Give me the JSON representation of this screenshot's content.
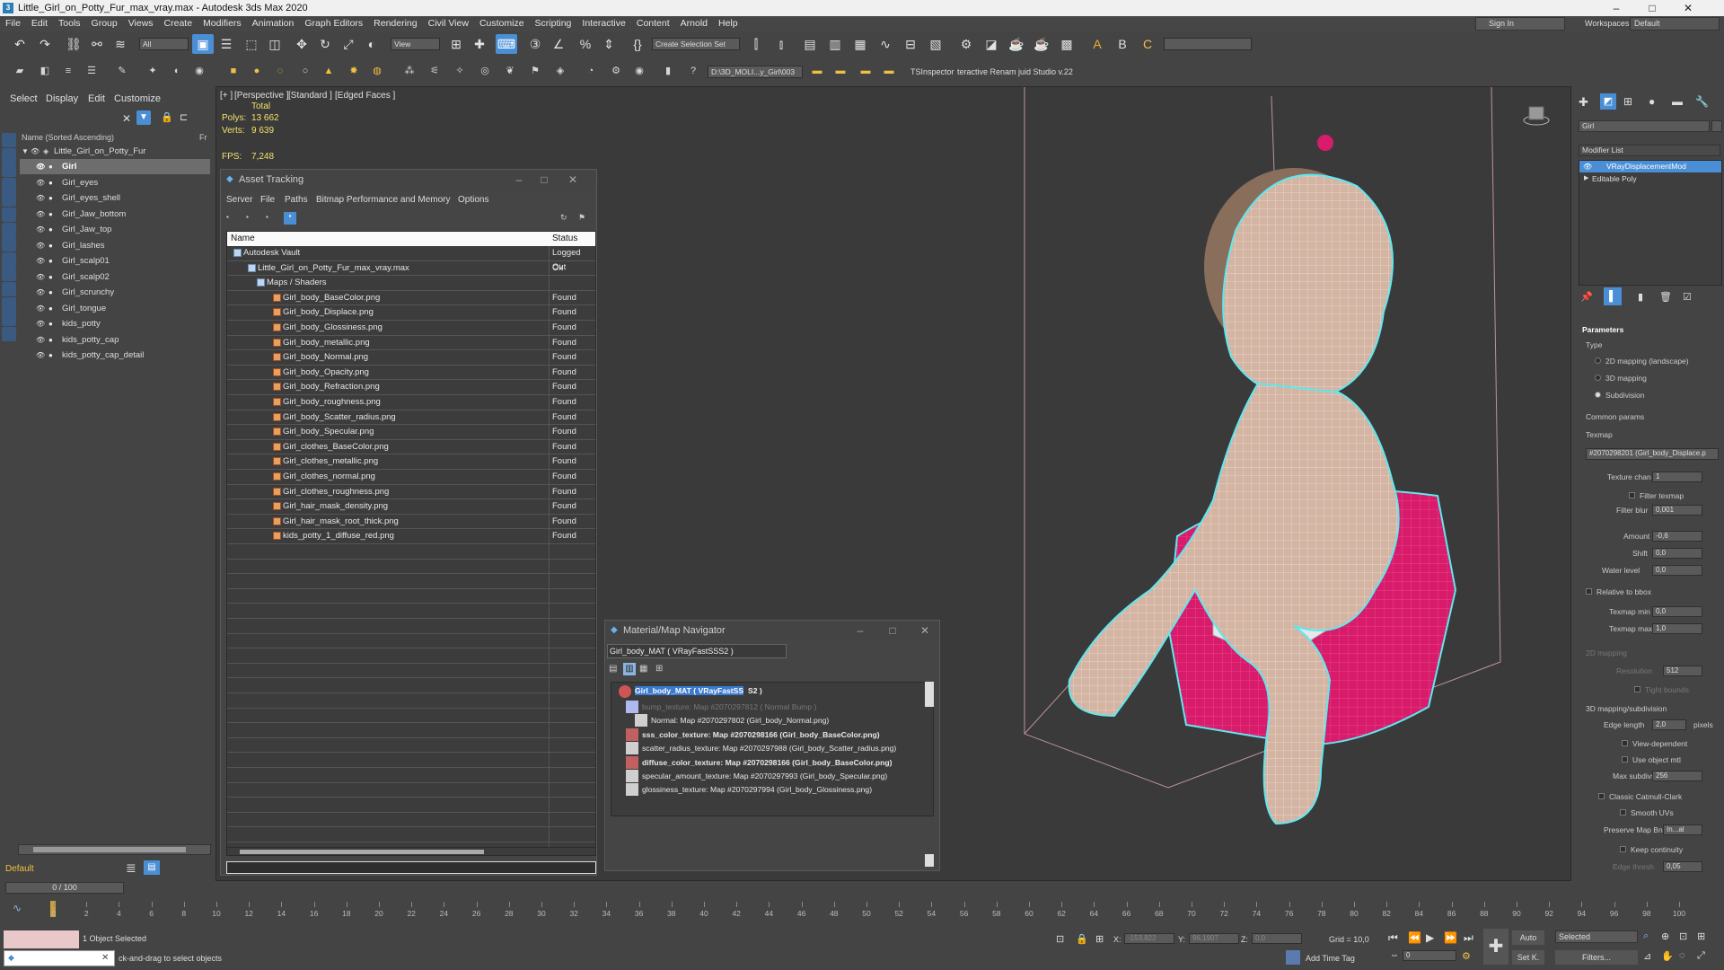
{
  "app": {
    "title": "Little_Girl_on_Potty_Fur_max_vray.max - Autodesk 3ds Max 2020",
    "menu": [
      "File",
      "Edit",
      "Tools",
      "Group",
      "Views",
      "Create",
      "Modifiers",
      "Animation",
      "Graph Editors",
      "Rendering",
      "Civil View",
      "Customize",
      "Scripting",
      "Interactive",
      "Content",
      "Arnold",
      "Help"
    ],
    "sign_in": "Sign In",
    "workspaces_label": "Workspaces:",
    "workspace_value": "Default"
  },
  "toolbar": {
    "filter_value": "All",
    "view_value": "View",
    "selection_set": "Create Selection Set",
    "path_value": "D:\\3D_MOLI...y_Girl\\003",
    "tsinspector": "TSInspector",
    "renamer": "teractive Renam juid Studio v.22"
  },
  "scene_explorer": {
    "tabs": [
      "Select",
      "Display",
      "Edit",
      "Customize"
    ],
    "column_header": "Name (Sorted Ascending)",
    "column_fr": "Fr",
    "root": "Little_Girl_on_Potty_Fur",
    "items": [
      "Girl",
      "Girl_eyes",
      "Girl_eyes_shell",
      "Girl_Jaw_bottom",
      "Girl_Jaw_top",
      "Girl_lashes",
      "Girl_scalp01",
      "Girl_scalp02",
      "Girl_scrunchy",
      "Girl_tongue",
      "kids_potty",
      "kids_potty_cap",
      "kids_potty_cap_detail"
    ],
    "layer": "Default",
    "frame_counter": "0 / 100"
  },
  "viewport": {
    "label_plus": "[+ ]",
    "label_view": "[Perspective ]",
    "label_shading": "[Standard ]",
    "label_edged": "[Edged Faces ]",
    "stats_total": "Total",
    "polys_label": "Polys:",
    "polys_value": "13 662",
    "verts_label": "Verts:",
    "verts_value": "9 639",
    "fps_label": "FPS:",
    "fps_value": "7,248"
  },
  "asset_tracking": {
    "title": "Asset Tracking",
    "menu": [
      "Server",
      "File",
      "Paths",
      "Bitmap Performance and Memory",
      "Options"
    ],
    "col_name": "Name",
    "col_status": "Status",
    "rows": [
      {
        "name": "Autodesk Vault",
        "status": "Logged Out",
        "indent": 1
      },
      {
        "name": "Little_Girl_on_Potty_Fur_max_vray.max",
        "status": "Ok",
        "indent": 2
      },
      {
        "name": "Maps / Shaders",
        "status": "",
        "indent": 3
      },
      {
        "name": "Girl_body_BaseColor.png",
        "status": "Found",
        "indent": 4
      },
      {
        "name": "Girl_body_Displace.png",
        "status": "Found",
        "indent": 4
      },
      {
        "name": "Girl_body_Glossiness.png",
        "status": "Found",
        "indent": 4
      },
      {
        "name": "Girl_body_metallic.png",
        "status": "Found",
        "indent": 4
      },
      {
        "name": "Girl_body_Normal.png",
        "status": "Found",
        "indent": 4
      },
      {
        "name": "Girl_body_Opacity.png",
        "status": "Found",
        "indent": 4
      },
      {
        "name": "Girl_body_Refraction.png",
        "status": "Found",
        "indent": 4
      },
      {
        "name": "Girl_body_roughness.png",
        "status": "Found",
        "indent": 4
      },
      {
        "name": "Girl_body_Scatter_radius.png",
        "status": "Found",
        "indent": 4
      },
      {
        "name": "Girl_body_Specular.png",
        "status": "Found",
        "indent": 4
      },
      {
        "name": "Girl_clothes_BaseColor.png",
        "status": "Found",
        "indent": 4
      },
      {
        "name": "Girl_clothes_metallic.png",
        "status": "Found",
        "indent": 4
      },
      {
        "name": "Girl_clothes_normal.png",
        "status": "Found",
        "indent": 4
      },
      {
        "name": "Girl_clothes_roughness.png",
        "status": "Found",
        "indent": 4
      },
      {
        "name": "Girl_hair_mask_density.png",
        "status": "Found",
        "indent": 4
      },
      {
        "name": "Girl_hair_mask_root_thick.png",
        "status": "Found",
        "indent": 4
      },
      {
        "name": "kids_potty_1_diffuse_red.png",
        "status": "Found",
        "indent": 4
      }
    ]
  },
  "material_navigator": {
    "title": "Material/Map Navigator",
    "current": "Girl_body_MAT  ( VRayFastSSS2 )",
    "root_prefix": "Girl_body_MAT  ( VRayFastSS",
    "root_suffix": "S2 )",
    "rows": [
      {
        "text": "bump_texture: Map #2070297812  ( Normal Bump )",
        "bold": false,
        "dim": true
      },
      {
        "text": "Normal: Map #2070297802 (Girl_body_Normal.png)",
        "bold": false,
        "dim": false
      },
      {
        "text": "sss_color_texture: Map #2070298166 (Girl_body_BaseColor.png)",
        "bold": true,
        "dim": false
      },
      {
        "text": "scatter_radius_texture: Map #2070297988 (Girl_body_Scatter_radius.png)",
        "bold": false,
        "dim": false
      },
      {
        "text": "diffuse_color_texture: Map #2070298166 (Girl_body_BaseColor.png)",
        "bold": true,
        "dim": false
      },
      {
        "text": "specular_amount_texture: Map #2070297993 (Girl_body_Specular.png)",
        "bold": false,
        "dim": false
      },
      {
        "text": "glossiness_texture: Map #2070297994 (Girl_body_Glossiness.png)",
        "bold": false,
        "dim": false
      }
    ]
  },
  "command_panel": {
    "object_name": "Girl",
    "modifier_list": "Modifier List",
    "stack": [
      "VRayDisplacementMod",
      "Editable Poly"
    ],
    "rollout": "Parameters",
    "type_label": "Type",
    "type_options": [
      "2D mapping (landscape)",
      "3D mapping",
      "Subdivision"
    ],
    "common_params": "Common params",
    "texmap_label": "Texmap",
    "texmap_value": "#2070298201 (Girl_body_Displace.p",
    "texture_chan_label": "Texture chan",
    "texture_chan_value": "1",
    "filter_texmap": "Filter texmap",
    "filter_blur_label": "Filter blur",
    "filter_blur_value": "0,001",
    "amount_label": "Amount",
    "amount_value": "-0,6",
    "shift_label": "Shift",
    "shift_value": "0,0",
    "water_level_label": "Water level",
    "water_level_value": "0,0",
    "relative_bbox": "Relative to bbox",
    "texmap_min_label": "Texmap min",
    "texmap_min_value": "0,0",
    "texmap_max_label": "Texmap max",
    "texmap_max_value": "1,0",
    "mapping2d": "2D mapping",
    "resolution_label": "Resolution",
    "resolution_value": "512",
    "tight_bounds": "Tight bounds",
    "mapping3d": "3D mapping/subdivision",
    "edge_length_label": "Edge length",
    "edge_length_value": "2,0",
    "pixels": "pixels",
    "view_dependent": "View-dependent",
    "use_object_mtl": "Use object mtl",
    "max_subdivs_label": "Max subdivs",
    "max_subdivs_value": "256",
    "classic_catmull": "Classic Catmull-Clark",
    "smooth_uvs": "Smooth UVs",
    "preserve_map_bnd": "Preserve Map Bnd",
    "preserve_map_value": "In...al",
    "keep_continuity": "Keep continuity",
    "edge_thresh_label": "Edge thresh",
    "edge_thresh_value": "0,05"
  },
  "timeline": {
    "ticks": [
      "0",
      "2",
      "4",
      "6",
      "8",
      "10",
      "12",
      "14",
      "16",
      "18",
      "20",
      "22",
      "24",
      "26",
      "28",
      "30",
      "32",
      "34",
      "36",
      "38",
      "40",
      "42",
      "44",
      "46",
      "48",
      "50",
      "52",
      "54",
      "56",
      "58",
      "60",
      "62",
      "64",
      "66",
      "68",
      "70",
      "72",
      "74",
      "76",
      "78",
      "80",
      "82",
      "84",
      "86",
      "88",
      "90",
      "92",
      "94",
      "96",
      "98",
      "100"
    ]
  },
  "status": {
    "selection": "1 Object Selected",
    "hint": "ck-and-drag to select objects",
    "x_label": "X:",
    "x_value": "-153,822",
    "y_label": "Y:",
    "y_value": "96,1907",
    "z_label": "Z:",
    "z_value": "0,0",
    "grid": "Grid = 10,0",
    "add_time_tag": "Add Time Tag",
    "auto": "Auto",
    "set_key": "Set K.",
    "selected": "Selected",
    "frame": "0",
    "filters": "Filters..."
  },
  "colors": {
    "accent": "#4a8fd6",
    "potty": "#d81b6a",
    "wire_highlight": "#5fe8f0",
    "skin": "#d9b6a4"
  }
}
